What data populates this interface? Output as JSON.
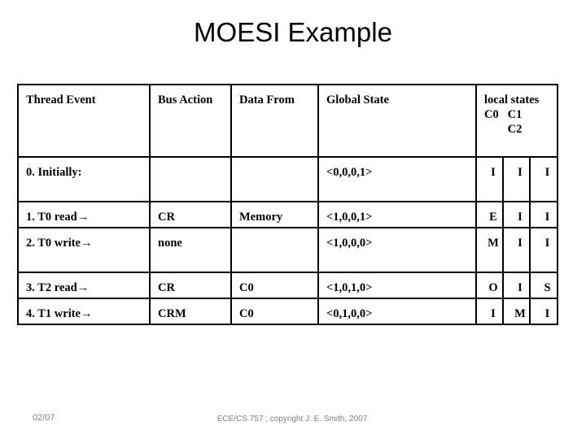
{
  "slide": {
    "title": "MOESI Example"
  },
  "table": {
    "headers": {
      "thread_event": "Thread Event",
      "bus_action": "Bus Action",
      "data_from": "Data From",
      "global_state": "Global State",
      "local_states_title": "local states",
      "local_states_line2": "C0   C1",
      "local_states_line3": "C2"
    },
    "rows": [
      {
        "thread_event": "0. Initially:",
        "bus_action": "",
        "data_from": "",
        "global_state": "<0,0,0,1>",
        "c0": "I",
        "c1": "I",
        "c2": "I"
      },
      {
        "thread_event": "1. T0 read→",
        "bus_action": "CR",
        "data_from": "Memory",
        "global_state": "<1,0,0,1>",
        "c0": "E",
        "c1": "I",
        "c2": "I"
      },
      {
        "thread_event": "2. T0 write→",
        "bus_action": "none",
        "data_from": "",
        "global_state": "<1,0,0,0>",
        "c0": "M",
        "c1": "I",
        "c2": "I"
      },
      {
        "thread_event": "3. T2 read→",
        "bus_action": "CR",
        "data_from": "C0",
        "global_state": "<1,0,1,0>",
        "c0": "O",
        "c1": "I",
        "c2": "S"
      },
      {
        "thread_event": "4. T1 write→",
        "bus_action": "CRM",
        "data_from": "C0",
        "global_state": "<0,1,0,0>",
        "c0": "I",
        "c1": "M",
        "c2": "I"
      }
    ]
  },
  "footer": {
    "left": "02/07",
    "center": "ECE/CS 757 ; copyright J. E. Smith, 2007"
  },
  "colors": {
    "text": "#000000",
    "border": "#000000",
    "footer_text": "#808080",
    "background": "#ffffff"
  }
}
